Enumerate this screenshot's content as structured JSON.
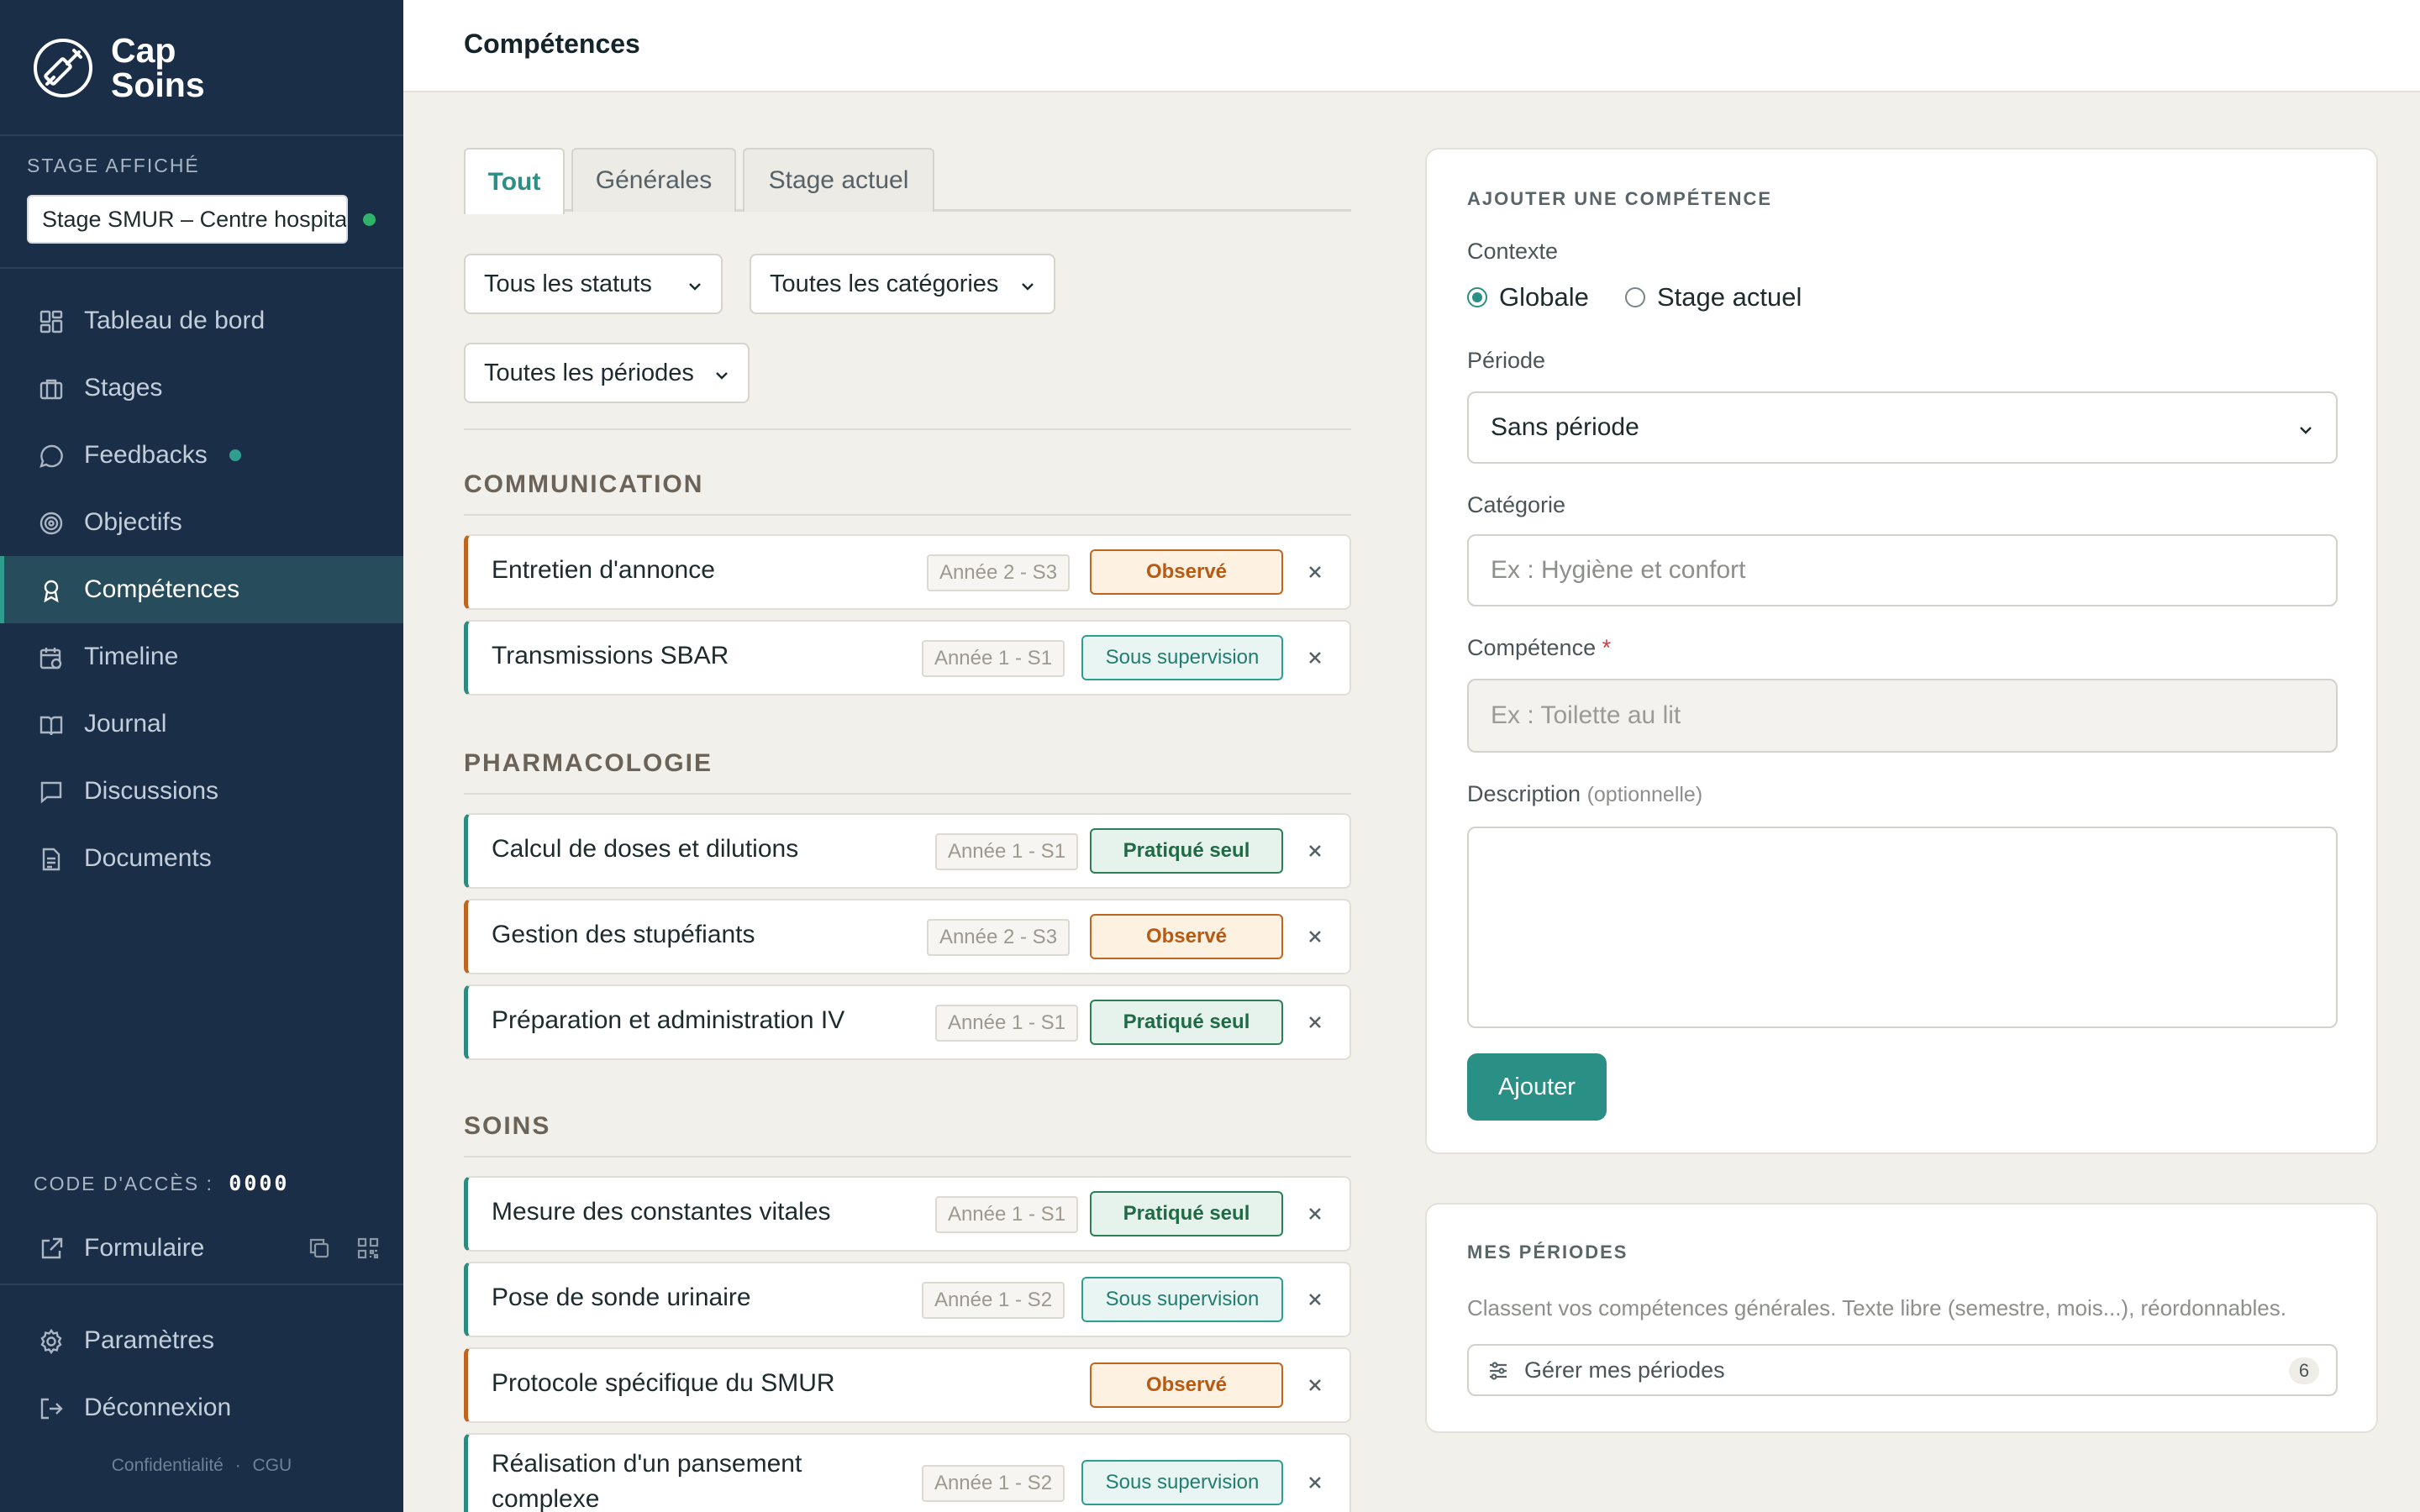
{
  "brand": {
    "name_line1": "Cap",
    "name_line2": "Soins"
  },
  "sidebar": {
    "stage_label": "STAGE AFFICHÉ",
    "stage_value": "Stage SMUR – Centre hospitalier",
    "nav": [
      {
        "label": "Tableau de bord",
        "icon": "dashboard-icon"
      },
      {
        "label": "Stages",
        "icon": "briefcase-icon"
      },
      {
        "label": "Feedbacks",
        "icon": "chat-icon"
      },
      {
        "label": "Objectifs",
        "icon": "target-icon"
      },
      {
        "label": "Compétences",
        "icon": "award-icon",
        "active": true
      },
      {
        "label": "Timeline",
        "icon": "calendar-icon"
      },
      {
        "label": "Journal",
        "icon": "book-icon"
      },
      {
        "label": "Discussions",
        "icon": "message-icon"
      },
      {
        "label": "Documents",
        "icon": "document-icon"
      }
    ],
    "access_label": "CODE D'ACCÈS :",
    "access_code": "0000",
    "formulaire": "Formulaire",
    "bottom": [
      {
        "label": "Paramètres",
        "icon": "gear-icon"
      },
      {
        "label": "Déconnexion",
        "icon": "logout-icon"
      }
    ],
    "footer": {
      "privacy": "Confidentialité",
      "sep": "·",
      "terms": "CGU"
    }
  },
  "header": {
    "title": "Compétences"
  },
  "tabs": [
    {
      "label": "Tout",
      "active": true
    },
    {
      "label": "Générales"
    },
    {
      "label": "Stage actuel"
    }
  ],
  "filters": {
    "status": "Tous les statuts",
    "category": "Toutes les catégories",
    "period": "Toutes les périodes"
  },
  "sections": [
    {
      "title": "COMMUNICATION",
      "items": [
        {
          "name": "Entretien d'annonce",
          "period": "Année 2 - S3",
          "status": "Observé",
          "kind": "obs"
        },
        {
          "name": "Transmissions SBAR",
          "period": "Année 1 - S1",
          "status": "Sous supervision",
          "kind": "sup"
        }
      ]
    },
    {
      "title": "PHARMACOLOGIE",
      "items": [
        {
          "name": "Calcul de doses et dilutions",
          "period": "Année 1 - S1",
          "status": "Pratiqué seul",
          "kind": "seul"
        },
        {
          "name": "Gestion des stupéfiants",
          "period": "Année 2 - S3",
          "status": "Observé",
          "kind": "obs"
        },
        {
          "name": "Préparation et administration IV",
          "period": "Année 1 - S1",
          "status": "Pratiqué seul",
          "kind": "seul"
        }
      ]
    },
    {
      "title": "SOINS",
      "items": [
        {
          "name": "Mesure des constantes vitales",
          "period": "Année 1 - S1",
          "status": "Pratiqué seul",
          "kind": "seul"
        },
        {
          "name": "Pose de sonde urinaire",
          "period": "Année 1 - S2",
          "status": "Sous supervision",
          "kind": "sup"
        },
        {
          "name": "Protocole spécifique du SMUR",
          "period": "",
          "status": "Observé",
          "kind": "obs"
        },
        {
          "name": "Réalisation d'un pansement complexe",
          "period": "Année 1 - S2",
          "status": "Sous supervision",
          "kind": "sup"
        }
      ]
    }
  ],
  "add_form": {
    "title": "AJOUTER UNE COMPÉTENCE",
    "context_label": "Contexte",
    "context_options": [
      "Globale",
      "Stage actuel"
    ],
    "context_selected": "Globale",
    "period_label": "Période",
    "period_value": "Sans période",
    "category_label": "Catégorie",
    "category_placeholder": "Ex : Hygiène et confort",
    "competence_label": "Compétence",
    "required_mark": "*",
    "competence_placeholder": "Ex : Toilette au lit",
    "description_label": "Description",
    "description_optional": "(optionnelle)",
    "submit": "Ajouter"
  },
  "periods_card": {
    "title": "MES PÉRIODES",
    "description": "Classent vos compétences générales. Texte libre (semestre, mois...), réordonnables.",
    "manage_label": "Gérer mes périodes",
    "count": "6"
  },
  "colors": {
    "sidebar": "#1a2e47",
    "accent": "#2a8f84",
    "observed": "#c0651f",
    "practiced": "#2d7f57"
  }
}
